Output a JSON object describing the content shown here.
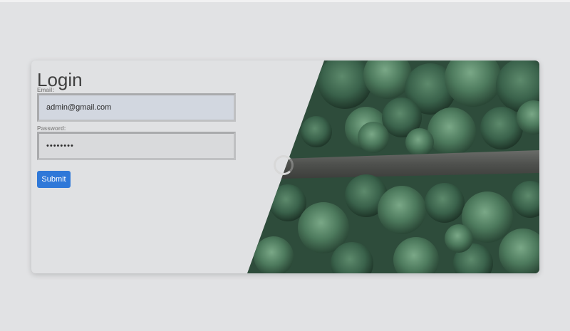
{
  "colors": {
    "page_background": "#e1e2e4",
    "card_background": "#e0e1e3",
    "submit_background": "#2f78d8",
    "submit_text": "#ffffff",
    "title_text": "#3f3f3f",
    "label_text": "#8a8a8a",
    "email_field_background": "#d2d7e0",
    "forest_dark": "#2c4a3a",
    "forest_light": "#5f8e6c",
    "road": "#545654"
  },
  "login": {
    "title": "Login",
    "email_label": "Email:",
    "email_value": "admin@gmail.com",
    "password_label": "Password:",
    "password_value": "••••••••",
    "submit_label": "Submit"
  },
  "hero": {
    "image_icon": "forest-aerial-image",
    "loading_icon": "loading-spinner-icon"
  }
}
